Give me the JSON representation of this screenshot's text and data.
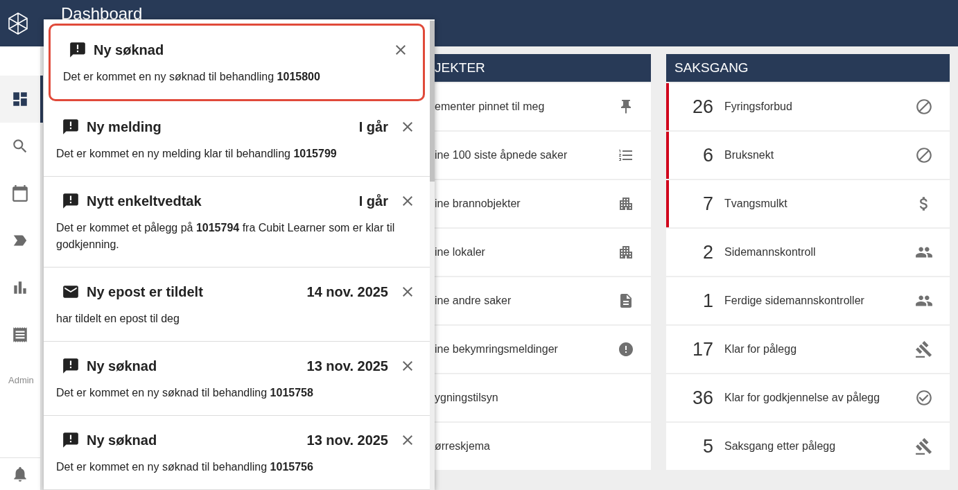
{
  "header": {
    "title": "Dashboard"
  },
  "sidebar": {
    "items": [
      {
        "kind": "dashboard",
        "selected": true
      },
      {
        "kind": "search",
        "selected": false
      },
      {
        "kind": "calendar",
        "selected": false
      },
      {
        "kind": "label",
        "selected": false
      },
      {
        "kind": "chart",
        "selected": false
      },
      {
        "kind": "receipt",
        "selected": false
      }
    ],
    "admin_label": "Admin"
  },
  "objects_panel": {
    "title": "JEKTER",
    "rows": [
      {
        "label": "ementer pinnet til meg",
        "kind": "pin"
      },
      {
        "label": "ine 100 siste åpnede saker",
        "kind": "list"
      },
      {
        "label": "ine brannobjekter",
        "kind": "building"
      },
      {
        "label": "ine lokaler",
        "kind": "building"
      },
      {
        "label": "ine andre saker",
        "kind": "document"
      },
      {
        "label": "ine bekymringsmeldinger",
        "kind": "alert"
      },
      {
        "label": "ygningstilsyn",
        "kind": "plain"
      },
      {
        "label": "ørreskjema",
        "kind": "plain"
      }
    ]
  },
  "saksgang_panel": {
    "title": "SAKSGANG",
    "rows": [
      {
        "count": "26",
        "label": "Fyringsforbud",
        "kind": "block",
        "flagged": true
      },
      {
        "count": "6",
        "label": "Bruksnekt",
        "kind": "block",
        "flagged": true
      },
      {
        "count": "7",
        "label": "Tvangsmulkt",
        "kind": "dollar",
        "flagged": true
      },
      {
        "count": "2",
        "label": "Sidemannskontroll",
        "kind": "people",
        "flagged": false
      },
      {
        "count": "1",
        "label": "Ferdige sidemannskontroller",
        "kind": "people",
        "flagged": false
      },
      {
        "count": "17",
        "label": "Klar for pålegg",
        "kind": "gavel",
        "flagged": false
      },
      {
        "count": "36",
        "label": "Klar for godkjennelse av pålegg",
        "kind": "check",
        "flagged": false
      },
      {
        "count": "5",
        "label": "Saksgang etter pålegg",
        "kind": "gavel",
        "flagged": false
      }
    ]
  },
  "notifications": [
    {
      "kind": "alert",
      "title": "Ny søknad",
      "body": "Det er kommet en ny søknad til behandling **1015800**",
      "highlighted": true
    },
    {
      "kind": "alert",
      "title": "Ny melding",
      "time": "I går",
      "body": "Det er kommet en ny melding klar til behandling **1015799**",
      "highlighted": false
    },
    {
      "kind": "alert",
      "title": "Nytt enkeltvedtak",
      "time": "I går",
      "body": "Det er kommet et pålegg på **1015794** fra Cubit Learner som er klar til godkjenning.",
      "highlighted": false
    },
    {
      "kind": "mail",
      "title": "Ny epost er tildelt",
      "time": "14 nov. 2025",
      "body": "har tildelt en epost til deg",
      "highlighted": false
    },
    {
      "kind": "alert",
      "title": "Ny søknad",
      "time": "13 nov. 2025",
      "body": "Det er kommet en ny søknad til behandling **1015758**",
      "highlighted": false
    },
    {
      "kind": "alert",
      "title": "Ny søknad",
      "time": "13 nov. 2025",
      "body": "Det er kommet en ny søknad til behandling **1015756**",
      "highlighted": false
    }
  ]
}
